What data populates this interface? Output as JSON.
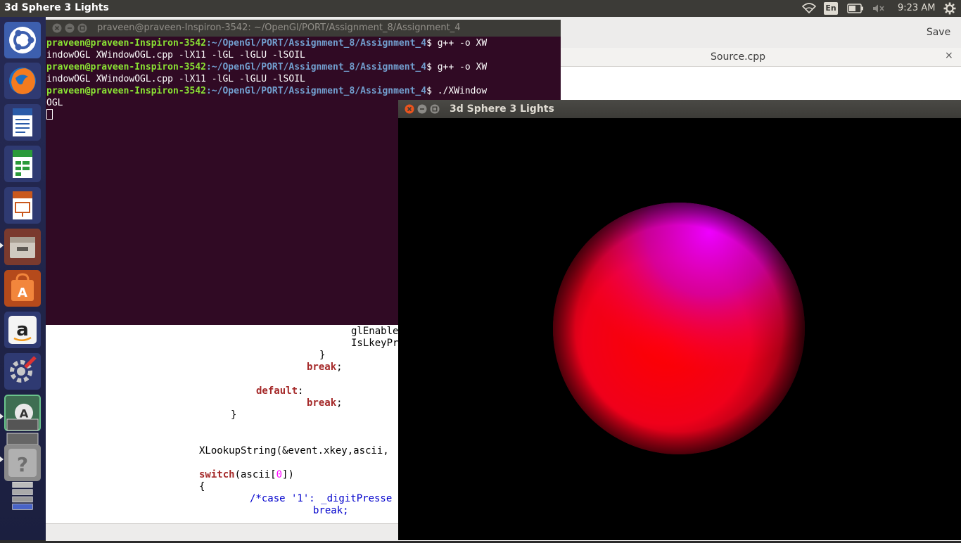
{
  "topbar": {
    "active_app": "3d Sphere 3 Lights",
    "lang": "En",
    "clock": "9:23 AM",
    "icons": [
      "wifi-icon",
      "keyboard-lang-icon",
      "battery-icon",
      "volume-muted-icon",
      "gear-icon"
    ]
  },
  "launcher": {
    "items": [
      "ubuntu-dash",
      "firefox",
      "libreoffice-writer",
      "libreoffice-calc",
      "libreoffice-impress",
      "files",
      "software-center",
      "amazon",
      "system-settings",
      "update-manager",
      "workspaces",
      "help",
      "trash"
    ]
  },
  "editor": {
    "save_label": "Save",
    "tab_label": "Source.cpp",
    "tab_close": "×",
    "code": {
      "l1": "glEnable",
      "l2": "IsLkeyPr",
      "l3": "}",
      "l4_kw": "break",
      "l4_rest": ";",
      "l5_kw": "default",
      "l5_rest": ":",
      "l6_kw": "break",
      "l6_rest": ";",
      "l7": "}",
      "l8": "XLookupString(&event.xkey,ascii,",
      "l9_kw": "switch",
      "l9_a": "(ascii[",
      "l9_num": "0",
      "l9_b": "])",
      "l10": "{",
      "l11": "/*case '1': _digitPresse",
      "l12": "break;"
    }
  },
  "terminal": {
    "title": "praveen@praveen-Inspiron-3542: ~/OpenGl/PORT/Assignment_8/Assignment_4",
    "prompt_user": "praveen@praveen-Inspiron-3542",
    "prompt_path": ":~/OpenGl/PORT/Assignment_8/Assignment_4",
    "cmd1a": "$ g++ -o XW",
    "cmd1b": "indowOGL XWindowOGL.cpp -lX11 -lGL -lGLU -lSOIL",
    "cmd2a": "$ g++ -o XW",
    "cmd2b": "indowOGL XWindowOGL.cpp -lX11 -lGL -lGLU -lSOIL",
    "cmd3a": "$ ./XWindow",
    "cmd3b": "OGL"
  },
  "glwindow": {
    "title": "3d Sphere 3 Lights",
    "colors": {
      "background": "#000000",
      "sphere_main": "#ff0000",
      "sphere_highlight": "#ee00ff",
      "sphere_shadow": "#2a0008"
    }
  }
}
